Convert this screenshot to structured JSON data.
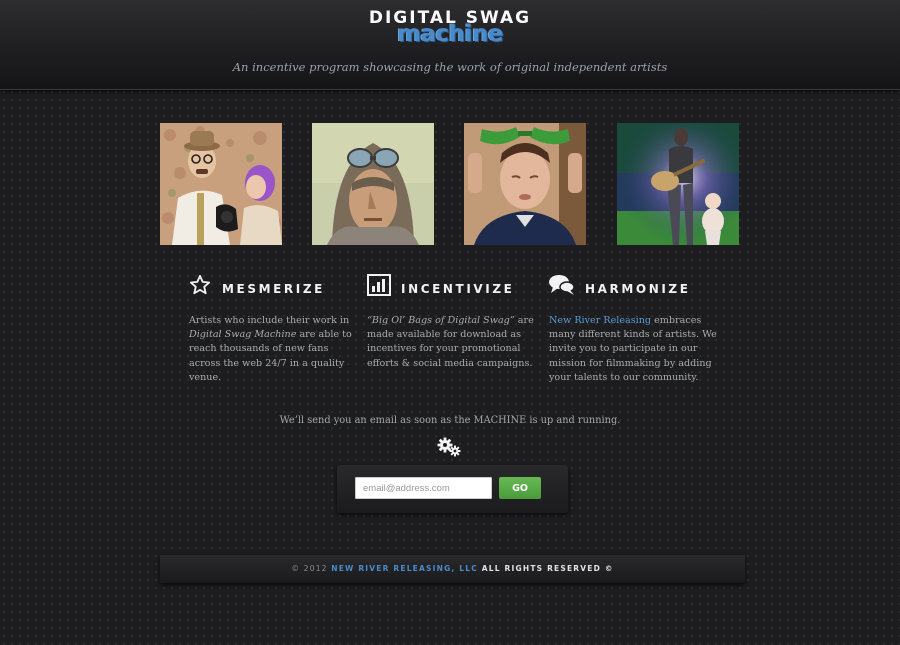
{
  "header": {
    "logo_line1": "DIGITAL SWAG",
    "logo_line2": "machine",
    "tagline": "An incentive program showcasing the work of original independent artists"
  },
  "features": [
    {
      "title": "MESMERIZE",
      "icon": "star-icon",
      "body_1": "Artists who include their work in ",
      "body_em": "Digital Swag Machine",
      "body_2": " are able to reach thousands of new fans across the web 24/7 in a quality venue."
    },
    {
      "title": "INCENTIVIZE",
      "icon": "bar-chart-icon",
      "body_em": "“Big Ol’ Bags of Digital Swag”",
      "body_2": " are made available for download as incentives for your promotional efforts & social media campaigns."
    },
    {
      "title": "HARMONIZE",
      "icon": "speech-bubbles-icon",
      "body_link": "New River Releasing",
      "body_2": " embraces many different kinds of artists. We invite you to participate in our mission for filmmaking by adding your talents to our community."
    }
  ],
  "signup": {
    "notice": "We’ll send you an email as soon as the MACHINE is up and running.",
    "icon": "gears-icon",
    "email_placeholder": "email@address.com",
    "go_label": "GO"
  },
  "footer": {
    "copyright": "© 2012 ",
    "company": "NEW RIVER RELEASING, LLC",
    "rights": " ALL RIGHTS RESERVED ©"
  },
  "colors": {
    "background": "#1d1d1f",
    "accent_blue": "#4a8ac8",
    "button_green": "#58a846"
  }
}
